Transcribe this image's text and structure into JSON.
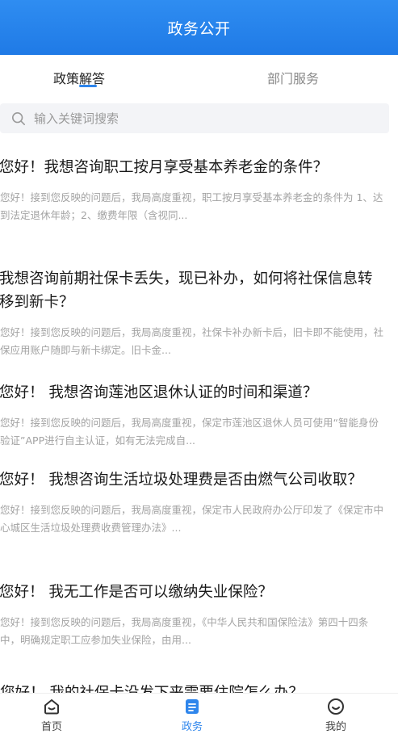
{
  "header": {
    "title": "政务公开"
  },
  "tabs": [
    {
      "label": "政策解答",
      "active": true
    },
    {
      "label": "部门服务",
      "active": false
    }
  ],
  "search": {
    "placeholder": "输入关键词搜索"
  },
  "items": [
    {
      "title": "您好！我想咨询职工按月享受基本养老金的条件？",
      "summary": "您好！接到您反映的问题后，我局高度重视，职工按月享受基本养老金的条件为 1、达到法定退休年龄；2、缴费年限（含视同..."
    },
    {
      "title": "我想咨询前期社保卡丢失，现已补办，如何将社保信息转移到新卡？",
      "summary": "您好！接到您反映的问题后，我局高度重视，社保卡补办新卡后，旧卡即不能使用，社保应用账户随即与新卡绑定。旧卡金..."
    },
    {
      "title": "您好！ 我想咨询莲池区退休认证的时间和渠道？",
      "summary": "您好！接到您反映的问题后，我局高度重视，保定市莲池区退休人员可使用“智能身份验证”APP进行自主认证，如有无法完成自..."
    },
    {
      "title": "您好！ 我想咨询生活垃圾处理费是否由燃气公司收取？",
      "summary": "您好！接到您反映的问题后，我局高度重视，保定市人民政府办公厅印发了《保定市中心城区生活垃圾处理费收费管理办法》..."
    },
    {
      "title": "您好！ 我无工作是否可以缴纳失业保险？",
      "summary": "您好！接到您反映的问题后，我局高度重视，《中华人民共和国保险法》第四十四条中，明确规定职工应参加失业保险，由用..."
    }
  ],
  "partial_item": {
    "title": "您好！ 我的社保卡没发下来需要住院怎么办？"
  },
  "bottom_nav": [
    {
      "label": "首页",
      "icon": "home-icon",
      "active": false
    },
    {
      "label": "政务",
      "icon": "affairs-icon",
      "active": true
    },
    {
      "label": "我的",
      "icon": "smile-icon",
      "active": false
    }
  ],
  "colors": {
    "header_bg": "#1f7ae6",
    "accent": "#2f86ec"
  }
}
